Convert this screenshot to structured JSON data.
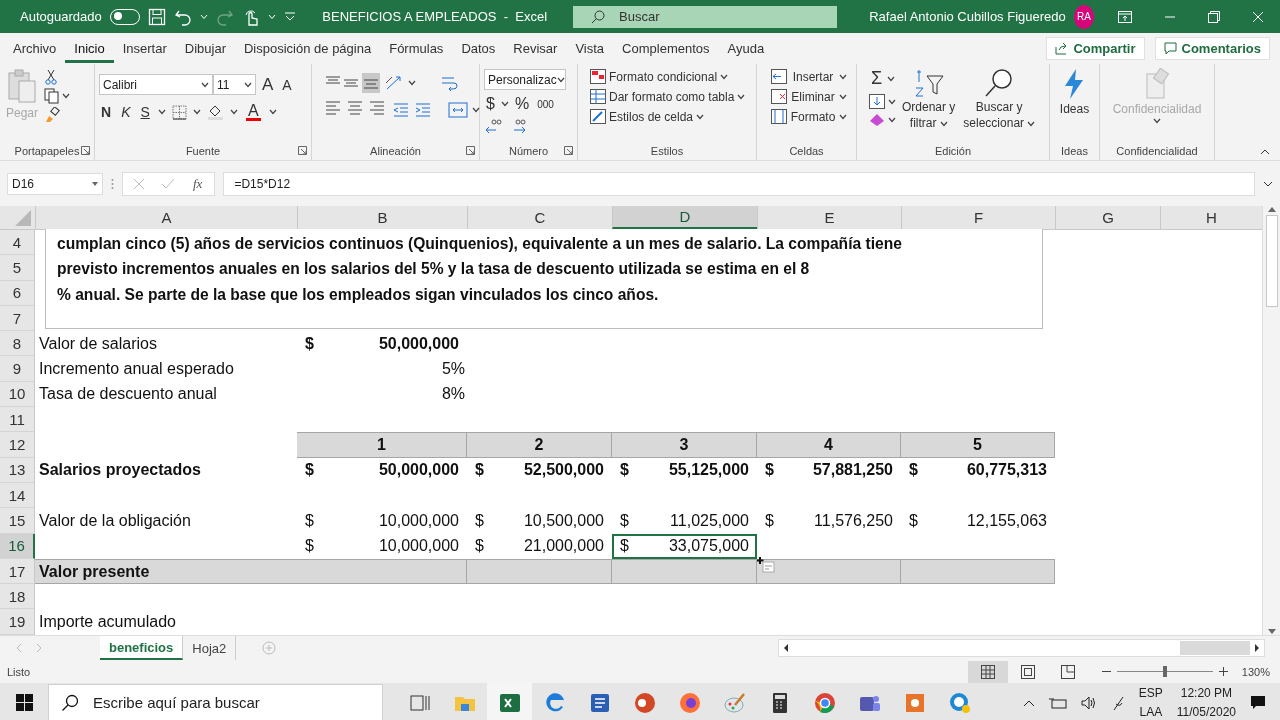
{
  "title_bar": {
    "autosave": {
      "label": "Autoguardado",
      "on": false
    },
    "redo_disabled": true,
    "title": "BENEFICIOS A EMPLEADOS  -  Excel",
    "search": {
      "placeholder": "Buscar"
    },
    "user": "Rafael Antonio Cubillos Figueredo",
    "avatar": "RA"
  },
  "menu": {
    "tabs": [
      {
        "label": "Archivo",
        "selected": false
      },
      {
        "label": "Inicio",
        "selected": true
      },
      {
        "label": "Insertar",
        "selected": false
      },
      {
        "label": "Dibujar",
        "selected": false
      },
      {
        "label": "Disposición de página",
        "selected": false
      },
      {
        "label": "Fórmulas",
        "selected": false
      },
      {
        "label": "Datos",
        "selected": false
      },
      {
        "label": "Revisar",
        "selected": false
      },
      {
        "label": "Vista",
        "selected": false
      },
      {
        "label": "Complementos",
        "selected": false
      },
      {
        "label": "Ayuda",
        "selected": false
      }
    ],
    "share": "Compartir",
    "comments": "Comentarios"
  },
  "ribbon": {
    "groups": [
      {
        "kind": "clipboard",
        "label": "Portapapeles",
        "launcher": true,
        "paste": "Pegar"
      },
      {
        "kind": "font",
        "label": "Fuente",
        "launcher": true,
        "font": "Calibri",
        "size": "11",
        "grow": "A",
        "shrink": "A",
        "bold": "N",
        "italic": "K",
        "underline": "S",
        "font_color": "A"
      },
      {
        "kind": "alignment",
        "label": "Alineación",
        "launcher": true
      },
      {
        "kind": "number",
        "label": "Número",
        "launcher": true,
        "format": "Personalizac",
        "currency": "$",
        "percent": "%",
        "thousands": "000"
      },
      {
        "kind": "styles",
        "label": "Estilos",
        "launcher": false,
        "items": [
          "Formato condicional",
          "Dar formato como tabla",
          "Estilos de celda"
        ]
      },
      {
        "kind": "cells",
        "label": "Celdas",
        "launcher": false,
        "items": [
          "Insertar",
          "Eliminar",
          "Formato"
        ]
      },
      {
        "kind": "editing",
        "label": "Edición",
        "launcher": false,
        "sum": "Σ",
        "sort": [
          "Ordenar y",
          "filtrar"
        ],
        "find": [
          "Buscar y",
          "seleccionar"
        ]
      },
      {
        "kind": "ideas",
        "label": "Ideas",
        "launcher": false,
        "button": "Ideas"
      },
      {
        "kind": "sensitivity",
        "label": "Confidencialidad",
        "launcher": false,
        "button": "Confidencialidad",
        "disabled": true
      }
    ]
  },
  "formula_bar": {
    "name_box": "D16",
    "fx": "fx",
    "formula": "=D15*D12"
  },
  "sheet": {
    "columns": [
      {
        "label": "A",
        "selected": false
      },
      {
        "label": "B",
        "selected": false
      },
      {
        "label": "C",
        "selected": false
      },
      {
        "label": "D",
        "selected": true
      },
      {
        "label": "E",
        "selected": false
      },
      {
        "label": "F",
        "selected": false
      },
      {
        "label": "G",
        "selected": false
      },
      {
        "label": "H",
        "selected": false
      }
    ],
    "text_box": {
      "lines": [
        "cumplan cinco (5) años de servicios continuos (Quinquenios), equivalente a un mes de salario. La compañía tiene",
        "previsto incrementos anuales en los salarios del 5% y la tasa de descuento utilizada se estima en el 8",
        "% anual. Se parte de la base que los empleados sigan vinculados los cinco años."
      ]
    },
    "rows": [
      {
        "number": "4",
        "selected": false,
        "shaded": false
      },
      {
        "number": "5",
        "selected": false,
        "shaded": false
      },
      {
        "number": "6",
        "selected": false,
        "shaded": false
      },
      {
        "number": "7",
        "selected": false,
        "shaded": false
      },
      {
        "number": "8",
        "selected": false,
        "shaded": false,
        "A": {
          "kind": "text",
          "value": "Valor de salarios",
          "bold": false,
          "selected": false
        },
        "B": {
          "kind": "money",
          "symbol": "$",
          "value": "50,000,000",
          "bold": true,
          "selected": false
        }
      },
      {
        "number": "9",
        "selected": false,
        "shaded": false,
        "A": {
          "kind": "text",
          "value": "Incremento anual esperado",
          "bold": false,
          "selected": false
        },
        "B": {
          "kind": "number",
          "value": "5%",
          "bold": false,
          "selected": false
        }
      },
      {
        "number": "10",
        "selected": false,
        "shaded": false,
        "A": {
          "kind": "text",
          "value": "Tasa de descuento anual",
          "bold": false,
          "selected": false
        },
        "B": {
          "kind": "number",
          "value": "8%",
          "bold": false,
          "selected": false
        }
      },
      {
        "number": "11",
        "selected": false,
        "shaded": false
      },
      {
        "number": "12",
        "selected": false,
        "shaded": true,
        "B": {
          "kind": "heading",
          "value": "1",
          "bold": true,
          "selected": false
        },
        "C": {
          "kind": "heading",
          "value": "2",
          "bold": true,
          "selected": false
        },
        "D": {
          "kind": "heading",
          "value": "3",
          "bold": true,
          "selected": false
        },
        "E": {
          "kind": "heading",
          "value": "4",
          "bold": true,
          "selected": false
        },
        "F": {
          "kind": "heading",
          "value": "5",
          "bold": true,
          "selected": false
        }
      },
      {
        "number": "13",
        "selected": false,
        "shaded": false,
        "A": {
          "kind": "text",
          "value": "Salarios proyectados",
          "bold": true,
          "selected": false
        },
        "B": {
          "kind": "money",
          "symbol": "$",
          "value": "50,000,000",
          "bold": true,
          "selected": false
        },
        "C": {
          "kind": "money",
          "symbol": "$",
          "value": "52,500,000",
          "bold": true,
          "selected": false
        },
        "D": {
          "kind": "money",
          "symbol": "$",
          "value": "55,125,000",
          "bold": true,
          "selected": false
        },
        "E": {
          "kind": "money",
          "symbol": "$",
          "value": "57,881,250",
          "bold": true,
          "selected": false
        },
        "F": {
          "kind": "money",
          "symbol": "$",
          "value": "60,775,313",
          "bold": true,
          "selected": false
        }
      },
      {
        "number": "14",
        "selected": false,
        "shaded": false
      },
      {
        "number": "15",
        "selected": false,
        "shaded": false,
        "A": {
          "kind": "text",
          "value": "Valor de la obligación",
          "bold": false,
          "selected": false
        },
        "B": {
          "kind": "money",
          "symbol": "$",
          "value": "10,000,000",
          "bold": false,
          "selected": false
        },
        "C": {
          "kind": "money",
          "symbol": "$",
          "value": "10,500,000",
          "bold": false,
          "selected": false
        },
        "D": {
          "kind": "money",
          "symbol": "$",
          "value": "11,025,000",
          "bold": false,
          "selected": false
        },
        "E": {
          "kind": "money",
          "symbol": "$",
          "value": "11,576,250",
          "bold": false,
          "selected": false
        },
        "F": {
          "kind": "money",
          "symbol": "$",
          "value": "12,155,063",
          "bold": false,
          "selected": false
        }
      },
      {
        "number": "16",
        "selected": true,
        "shaded": false,
        "B": {
          "kind": "money",
          "symbol": "$",
          "value": "10,000,000",
          "bold": false,
          "selected": false
        },
        "C": {
          "kind": "money",
          "symbol": "$",
          "value": "21,000,000",
          "bold": false,
          "selected": false
        },
        "D": {
          "kind": "money",
          "symbol": "$",
          "value": "33,075,000",
          "bold": false,
          "selected": true
        }
      },
      {
        "number": "17",
        "selected": false,
        "shaded": true,
        "A": {
          "kind": "text",
          "value": "Valor presente",
          "bold": true,
          "selected": false
        }
      },
      {
        "number": "18",
        "selected": false,
        "shaded": false
      },
      {
        "number": "19",
        "selected": false,
        "shaded": false,
        "A": {
          "kind": "text",
          "value": "Importe acumulado",
          "bold": false,
          "selected": false
        }
      }
    ]
  },
  "sheet_tabs": [
    {
      "label": "beneficios",
      "selected": true
    },
    {
      "label": "Hoja2",
      "selected": false
    }
  ],
  "status_bar": {
    "status": "Listo",
    "views": [
      {
        "selected": true
      },
      {
        "selected": false
      },
      {
        "selected": false
      }
    ],
    "zoom": {
      "level": 0.5,
      "reading": "130%"
    }
  },
  "taskbar": {
    "search": {
      "placeholder": "Escribe aquí para buscar"
    },
    "apps": [
      {
        "open": false,
        "active": false
      },
      {
        "open": true,
        "active": false
      },
      {
        "open": true,
        "active": true
      },
      {
        "open": true,
        "active": false
      },
      {
        "open": false,
        "active": false
      },
      {
        "open": false,
        "active": false
      },
      {
        "open": false,
        "active": false
      },
      {
        "open": false,
        "active": false
      },
      {
        "open": true,
        "active": false
      },
      {
        "open": true,
        "active": false
      },
      {
        "open": false,
        "active": false
      },
      {
        "open": true,
        "active": false
      },
      {
        "open": false,
        "active": false
      }
    ],
    "language": [
      "ESP",
      "LAA"
    ],
    "time": "12:20 PM",
    "date": "11/05/2020"
  }
}
